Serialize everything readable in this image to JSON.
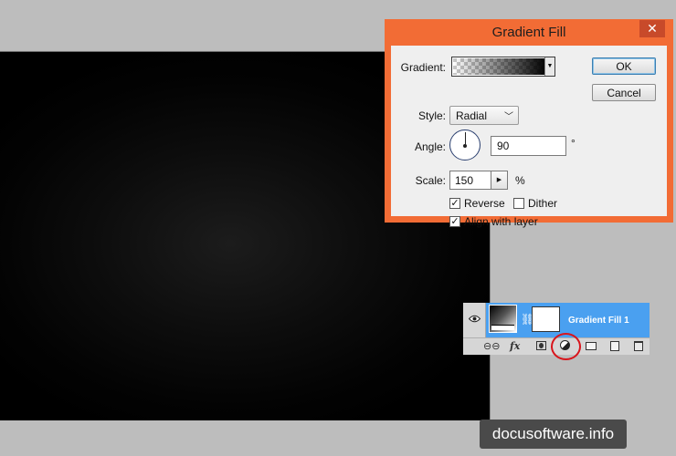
{
  "dialog": {
    "title": "Gradient Fill",
    "close_glyph": "✕",
    "gradient_label": "Gradient:",
    "style_label": "Style:",
    "style_value": "Radial",
    "angle_label": "Angle:",
    "angle_value": "90",
    "angle_unit": "°",
    "scale_label": "Scale:",
    "scale_value": "150",
    "scale_unit": "%",
    "reverse_label": "Reverse",
    "reverse_checked": true,
    "dither_label": "Dither",
    "dither_checked": false,
    "align_label": "Align with layer",
    "align_checked": true,
    "ok_label": "OK",
    "cancel_label": "Cancel"
  },
  "layers": {
    "layer_name": "Gradient Fill 1",
    "fx_label": "fx"
  },
  "watermark": "docusoftware.info",
  "colors": {
    "dialog_frame": "#f26c35",
    "layer_selected": "#4aa0f0",
    "highlight": "#d8151c"
  }
}
